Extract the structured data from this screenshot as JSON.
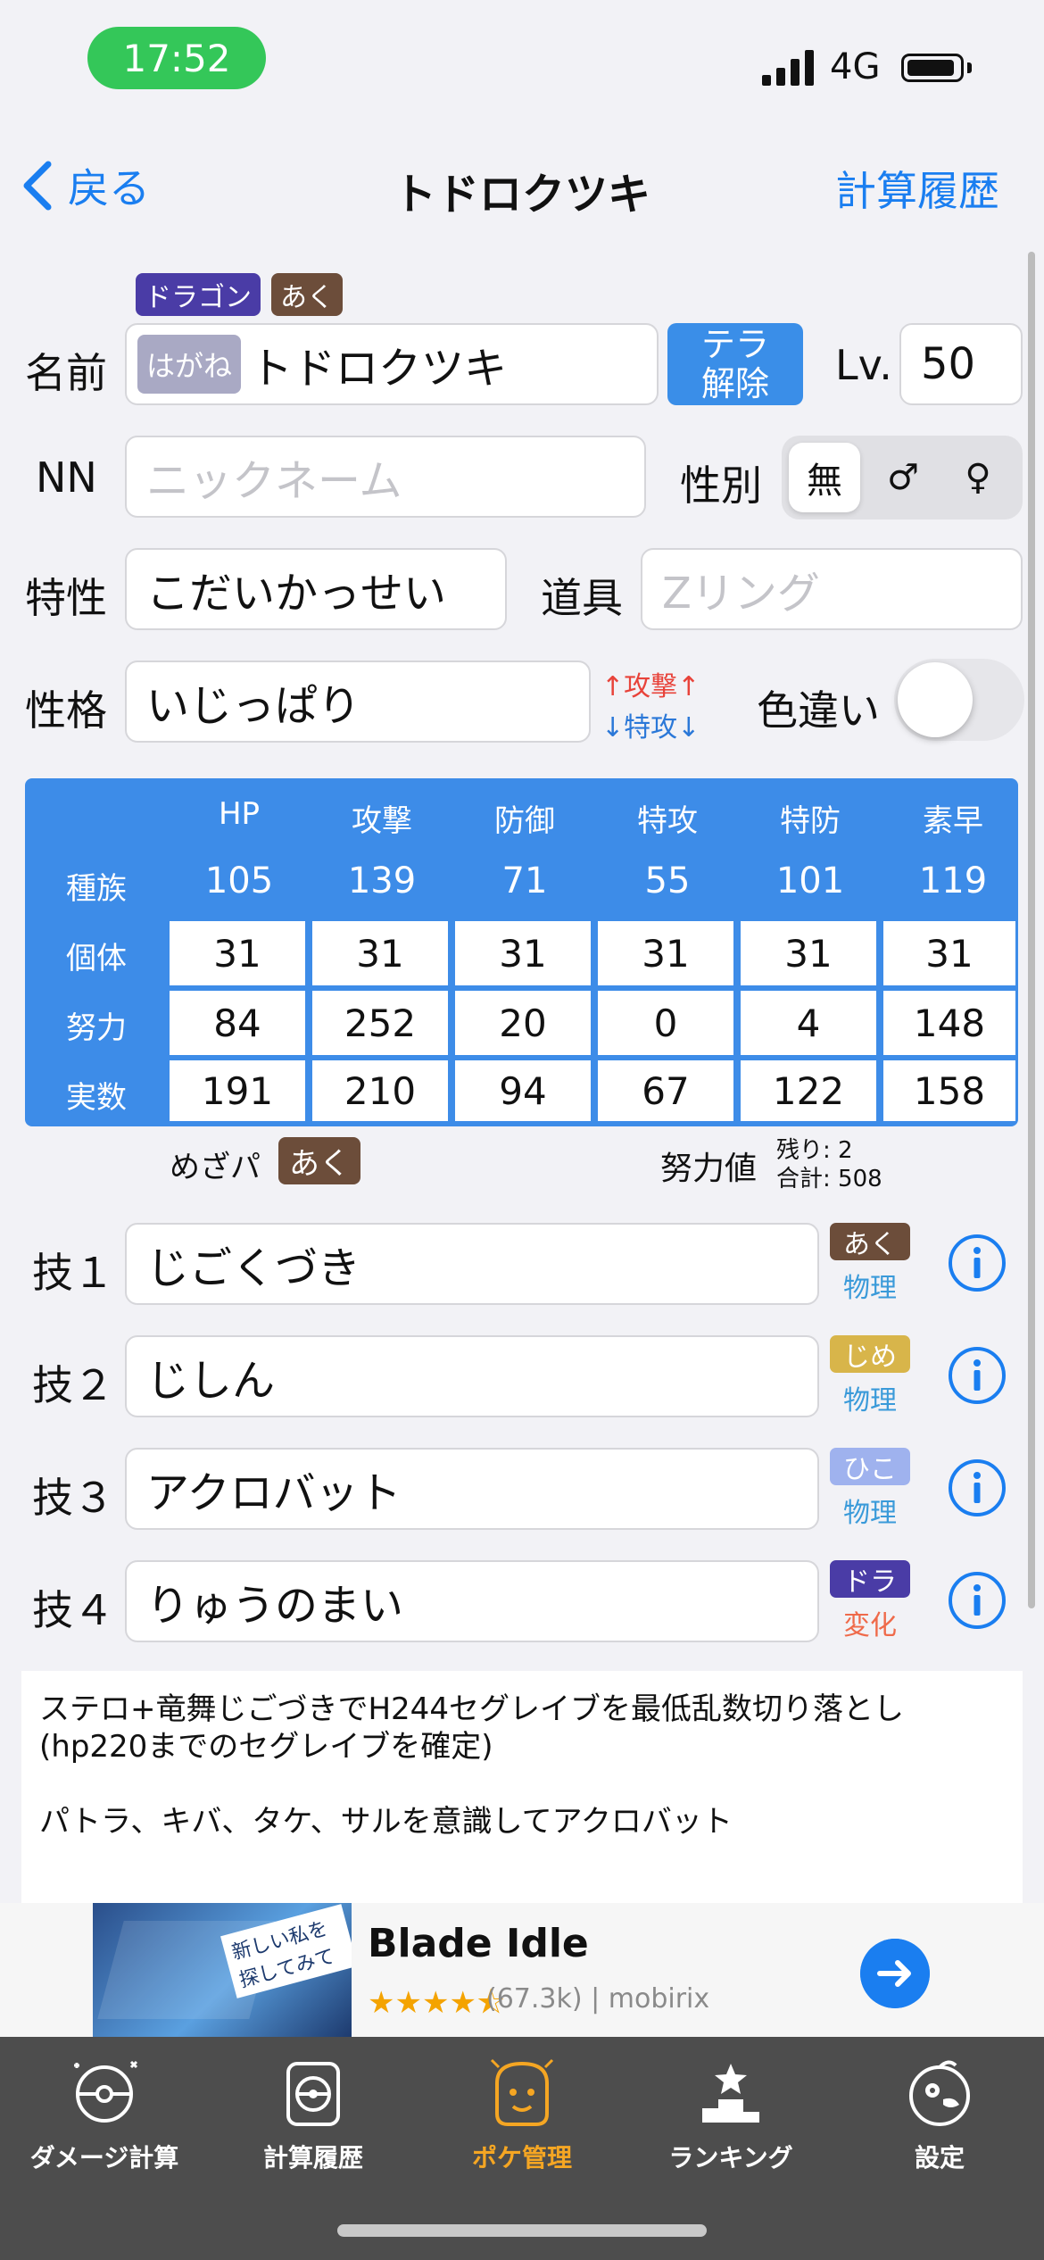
{
  "status": {
    "time": "17:52",
    "network": "4G"
  },
  "nav": {
    "back_label": "戻る",
    "title": "トドロクツキ",
    "right_label": "計算履歴"
  },
  "types": [
    {
      "label": "ドラゴン",
      "color": "#4a3ca6"
    },
    {
      "label": "あく",
      "color": "#6c4d3a"
    }
  ],
  "form": {
    "name_label": "名前",
    "tera_type": "はがね",
    "name_value": "トドロクツキ",
    "tera_button": [
      "テラ",
      "解除"
    ],
    "level_label": "Lv.",
    "level_value": "50",
    "nn_label": "NN",
    "nn_placeholder": "ニックネーム",
    "gender_label": "性別",
    "gender_options": [
      "無",
      "♂",
      "♀"
    ],
    "ability_label": "特性",
    "ability_value": "こだいかっせい",
    "item_label": "道具",
    "item_placeholder": "Zリング",
    "nature_label": "性格",
    "nature_value": "いじっぱり",
    "nature_up": "↑攻撃↑",
    "nature_down": "↓特攻↓",
    "shiny_label": "色違い"
  },
  "stats": {
    "headers": [
      "HP",
      "攻撃",
      "防御",
      "特攻",
      "特防",
      "素早"
    ],
    "row_labels": [
      "種族",
      "個体",
      "努力",
      "実数"
    ],
    "base": [
      "105",
      "139",
      "71",
      "55",
      "101",
      "119"
    ],
    "iv": [
      "31",
      "31",
      "31",
      "31",
      "31",
      "31"
    ],
    "ev": [
      "84",
      "252",
      "20",
      "0",
      "4",
      "148"
    ],
    "actual": [
      "191",
      "210",
      "94",
      "67",
      "122",
      "158"
    ]
  },
  "hidden_power": {
    "label": "めざパ",
    "type": "あく"
  },
  "ev_summary": {
    "label": "努力値",
    "remaining": "残り: 2",
    "total": "合計: 508"
  },
  "moves": [
    {
      "label": "技１",
      "name": "じごくづき",
      "type": "あく",
      "type_color": "#6c4d3a",
      "category": "物理",
      "cat_color": "#3a9ad9"
    },
    {
      "label": "技２",
      "name": "じしん",
      "type": "じめ",
      "type_color": "#d8b54a",
      "category": "物理",
      "cat_color": "#3a9ad9"
    },
    {
      "label": "技３",
      "name": "アクロバット",
      "type": "ひこ",
      "type_color": "#9fb2ee",
      "category": "物理",
      "cat_color": "#3a9ad9"
    },
    {
      "label": "技４",
      "name": "りゅうのまい",
      "type": "ドラ",
      "type_color": "#4a3ca6",
      "category": "変化",
      "cat_color": "#ef6a4a"
    }
  ],
  "memo": {
    "line1": "ステロ+竜舞じごづきでH244セグレイブを最低乱数切り落とし(hp220までのセグレイブを確定)",
    "line2": "パトラ、キバ、タケ、サルを意識してアクロバット"
  },
  "ad": {
    "title": "Blade Idle",
    "stars": "★★★★⯪",
    "rating": "(67.3k)",
    "developer": "mobirix",
    "image_text": "新しい私を探してみて"
  },
  "tabs": [
    {
      "label": "ダメージ計算",
      "icon": "calculator-ball-icon"
    },
    {
      "label": "計算履歴",
      "icon": "history-ball-icon"
    },
    {
      "label": "ポケ管理",
      "icon": "pokemon-box-icon",
      "active": true
    },
    {
      "label": "ランキング",
      "icon": "ranking-podium-icon"
    },
    {
      "label": "設定",
      "icon": "settings-bird-icon"
    }
  ]
}
